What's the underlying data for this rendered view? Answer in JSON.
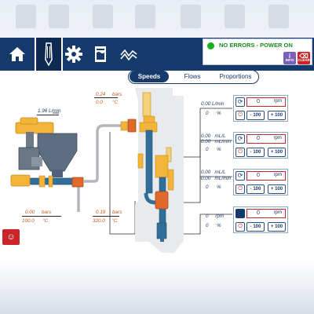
{
  "status": {
    "message": "NO ERRORS - POWER ON",
    "info_label": "INFO",
    "clear_label": "CLEAR"
  },
  "nav": {
    "items": [
      "home-icon",
      "pump-icon",
      "gear-icon",
      "recipe-icon",
      "trend-chart-icon"
    ],
    "active": "pump-icon"
  },
  "tabs": [
    {
      "label": "Speeds",
      "active": true
    },
    {
      "label": "Flows",
      "active": false
    },
    {
      "label": "Proportions",
      "active": false
    }
  ],
  "readouts": {
    "main_flow": "1.96",
    "main_flow_unit": "L/min",
    "top_pressure": "0.24",
    "top_pressure_unit": "bars",
    "top_temp": "0.0",
    "top_temp_unit": "°C",
    "left_pressure": "0.00",
    "left_pressure_unit": "bars",
    "left_temp": "100.0",
    "left_temp_unit": "°C",
    "mid_pressure": "0.19",
    "mid_pressure_unit": "bars",
    "mid_temp": "320.0",
    "mid_temp_unit": "°C"
  },
  "pumps": [
    {
      "l1": "0.00",
      "u1": "L/min",
      "l2": "0",
      "u2": "%",
      "l3": "",
      "u3": "",
      "set": "0",
      "unit": "rpm"
    },
    {
      "l1": "0.00",
      "u1": "mL/L",
      "l2": "0.00",
      "u2": "mL/min",
      "l3": "0",
      "u3": "%",
      "set": "0",
      "unit": "rpm"
    },
    {
      "l1": "0.00",
      "u1": "mL/L",
      "l2": "0.00",
      "u2": "mL/min",
      "l3": "0",
      "u3": "%",
      "set": "0",
      "unit": "rpm"
    },
    {
      "l1": "0",
      "u1": "rpm",
      "l2": "0",
      "u2": "%",
      "l3": "",
      "u3": "",
      "set": "0",
      "unit": "rpm"
    }
  ],
  "buttons": {
    "minus": "- 100",
    "plus": "+ 100"
  },
  "colors": {
    "navy": "#173a6d",
    "orange": "#e88a1a",
    "steel_blue": "#2f6f99",
    "alarm_red": "#c9262c",
    "ok_green": "#1bb01b"
  }
}
